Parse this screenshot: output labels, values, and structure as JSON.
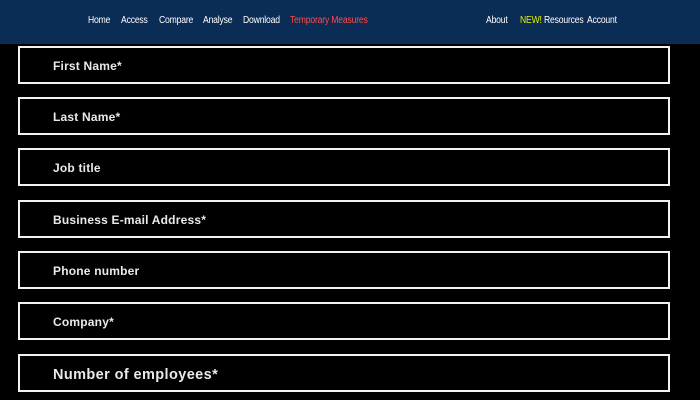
{
  "nav": {
    "left_links": [
      "Home",
      "Access",
      "Compare",
      "Analyse",
      "Download",
      "Temporary Measures"
    ],
    "active_link": "Temporary Measures",
    "resources_new_tag": "NEW!",
    "resources_label": " Resources",
    "about": "About",
    "account": "Account"
  },
  "colors": {
    "nav_background": "#0b2c55",
    "active_link": "#ff4b4b",
    "new_tag": "#e8f000",
    "page_background": "#000000",
    "field_border": "#f2f2f2"
  },
  "form": {
    "fields": [
      {
        "label": "First Name*"
      },
      {
        "label": "Last Name*"
      },
      {
        "label": "Job title"
      },
      {
        "label": "Business E-mail Address*"
      },
      {
        "label": "Phone number"
      },
      {
        "label": "Company*"
      },
      {
        "label": "Number of employees*"
      }
    ]
  }
}
